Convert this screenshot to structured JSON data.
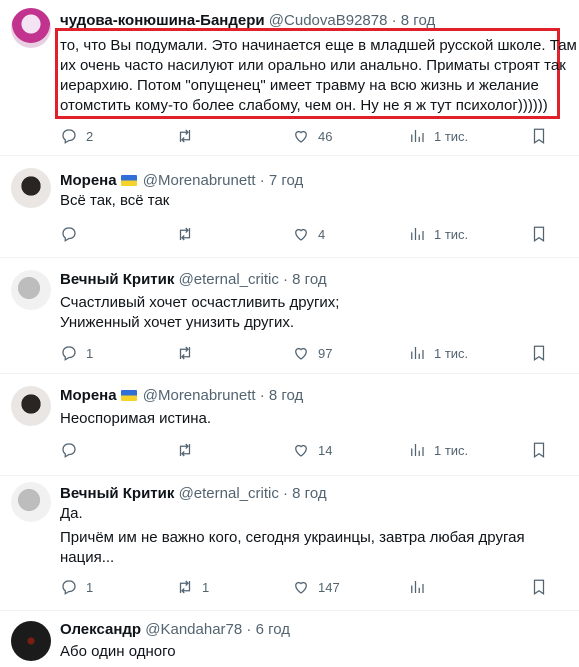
{
  "tweets": [
    {
      "name": "чудова-конюшина-Бандери",
      "handle": "@CudovaB92878",
      "time": "8 год",
      "flag": false,
      "lines": [
        "то, что Вы подумали. Это начинается еще в младшей русской школе. Там",
        "их очень часто насилуют или орально или анально. Приматы строят так",
        "иерархию. Потом \"опущенец\" имеет травму на всю жизнь и желание",
        "отомстить кому-то более слабому, чем он. Ну не я ж тут психолог))))))"
      ],
      "replies": "2",
      "retweets": "",
      "likes": "46",
      "views": "1 тис."
    },
    {
      "name": "Морена",
      "handle": "@Morenabrunett",
      "time": "7 год",
      "flag": true,
      "lines": [
        "Всё так, всё так"
      ],
      "replies": "",
      "retweets": "",
      "likes": "4",
      "views": "1 тис."
    },
    {
      "name": "Вечный Критик",
      "handle": "@eternal_critic",
      "time": "8 год",
      "flag": false,
      "lines": [
        "Счастливый хочет осчастливить других;",
        "Униженный хочет унизить других."
      ],
      "replies": "1",
      "retweets": "",
      "likes": "97",
      "views": "1 тис."
    },
    {
      "name": "Морена",
      "handle": "@Morenabrunett",
      "time": "8 год",
      "flag": true,
      "lines": [
        "Неоспоримая истина."
      ],
      "replies": "",
      "retweets": "",
      "likes": "14",
      "views": "1 тис."
    },
    {
      "name": "Вечный Критик",
      "handle": "@eternal_critic",
      "time": "8 год",
      "flag": false,
      "lines": [
        "Да.",
        "Причём им не важно кого, сегодня украинцы, завтра любая другая",
        "нация..."
      ],
      "replies": "1",
      "retweets": "1",
      "likes": "147",
      "views": ""
    },
    {
      "name": "Олександр",
      "handle": "@Kandahar78",
      "time": "6 год",
      "flag": false,
      "lines": [
        "Або один одного"
      ],
      "replies": "",
      "retweets": "",
      "likes": "",
      "views": ""
    }
  ],
  "separator": "·",
  "icons": [
    "reply-icon",
    "retweet-icon",
    "like-icon",
    "views-icon",
    "bookmark-icon"
  ],
  "colors": {
    "highlight": "#e0202b",
    "secondary_text": "#536471",
    "divider": "#eff3f4"
  }
}
